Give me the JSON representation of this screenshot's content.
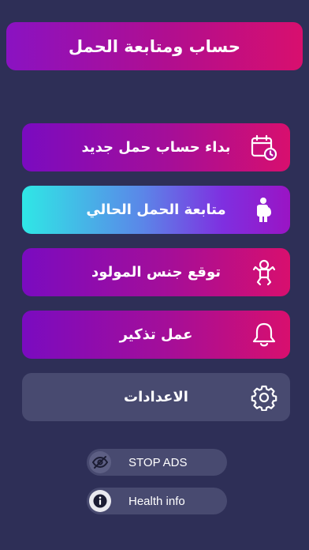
{
  "header": {
    "title": "حساب ومتابعة الحمل"
  },
  "menu": {
    "items": [
      {
        "label": "بداء حساب حمل جديد",
        "icon": "calendar-clock-icon"
      },
      {
        "label": "متابعة الحمل الحالي",
        "icon": "pregnant-woman-icon"
      },
      {
        "label": "توقع جنس المولود",
        "icon": "baby-icon"
      },
      {
        "label": "عمل تذكير",
        "icon": "bell-icon"
      },
      {
        "label": "الاعدادات",
        "icon": "gear-icon"
      }
    ]
  },
  "pills": {
    "stop_ads": {
      "label": "STOP ADS",
      "icon": "eye-off-icon"
    },
    "health_info": {
      "label": "Health info",
      "icon": "info-icon"
    }
  },
  "colors": {
    "background": "#2e2f57",
    "gradient_start": "#7a0bc0",
    "gradient_end": "#d80f6e",
    "active_start": "#2fe7e6",
    "neutral_button": "#484a70"
  }
}
